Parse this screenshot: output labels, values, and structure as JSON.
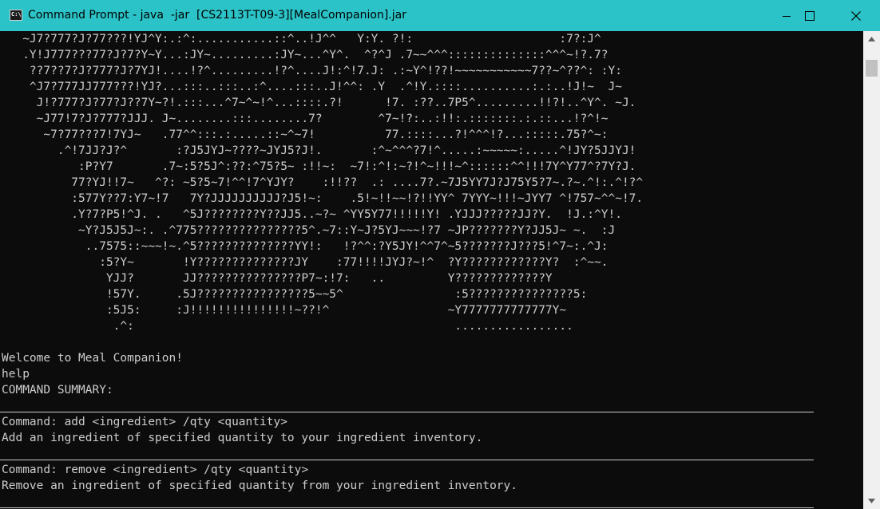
{
  "window": {
    "title": "Command Prompt - java  -jar  [CS2113T-T09-3][MealCompanion].jar",
    "controls": [
      "minimize-icon",
      "maximize-icon",
      "close-icon"
    ]
  },
  "console": {
    "ascii_art": [
      "   ~J7?777?J?77???!YJ^Y:.:^:...........::^..!J^^   Y:Y. ?!:                     :7?:J^",
      "   .Y!J777???77?J?7?Y~Y...:JY~.........:JY~...^Y^.  ^?^J .7~~^^^::::::::::::::^^^~!?.7?",
      "    ??7??7?J?777?J?7YJ!....!?^.........!?^....J!:^!7.J: .:~Y^!??!~~~~~~~~~~~7??~^??^: :Y:",
      "    ^J7?777JJ777???!YJ?...:::..:::..:^....:::..J!^^: .Y  .^!Y.::::..........:.:..!J!~  J~",
      "     J!?777?J?77?J??7Y~?!.:::...^7~^~!^...::::.?!      !7. :??..7P5^.........!!?!..^Y^. ~J.",
      "     ~J77!7?J?777?JJJ. J~........:::........7?        ^7~!?:..:!!:.:::::::.:.::...!?^!~",
      "      ~7?77???7!7YJ~   .77^^:::.:.....::~^~7!          77.::::...?!^^^!?...:::::.75?^~:",
      "        .^!7JJ?J?^       :?J5JYJ~????~JYJ5?J!.       :^~^^^?7!^.....:~~~~~:.....^!JY?5JJYJ!",
      "           :P?Y7       .7~:5?5J^:??:^75?5~ :!!~:  ~7!:^!:~?!^~!!!~^::::::^^!!!7Y^Y77^?7Y?J.",
      "          77?YJ!!7~   ^?: ~5?5~7!^^!7^YJY?    :!!??  .: ....7?.~7J5YY7J?J75Y5?7~.?~.^!:.^!?^",
      "          :577Y??7:Y7~!7   7Y?JJJJJJJJJJ?J5!~:    .5!~!!~~!?!!YY^ 7YYY~!!!~JYY7 ^!757~^^~!7.",
      "          .Y?7?P5!^J. .   ^5J????????Y??JJ5..~?~ ^YY5Y77!!!!!Y! .YJJJ?????JJ?Y.  !J.:^Y!.",
      "           ~Y?J5J5J~:. .^775???????????????5^.~7::Y~J?5YJ~~~!?7 ~JP???????Y?JJ5J~ ~.  :J",
      "            ..7575::~~~!~.^5??????????????YY!:   !?^^:?Y5JY!^^7^~5???????J???5!^7~:.^J:",
      "              :5?Y~       !Y??????????????JY    :77!!!!JYJ?~!^  ?Y????????????Y?  :^~~.",
      "               YJJ?       JJ???????????????P7~:!7:   ..         Y?????????????Y",
      "               !57Y.     .5J????????????????5~~5^                :5???????????????5:",
      "               :5J5:     :J!!!!!!!!!!!!!!!~??!^                 ~Y7777777777777Y~",
      "                .^:                                              ................."
    ],
    "welcome": "Welcome to Meal Companion!",
    "input_command": "help",
    "summary_heading": "COMMAND SUMMARY:",
    "commands": [
      {
        "command": "Command: add <ingredient> /qty <quantity>",
        "description": "Add an ingredient of specified quantity to your ingredient inventory."
      },
      {
        "command": "Command: remove <ingredient> /qty <quantity>",
        "description": "Remove an ingredient of specified quantity from your ingredient inventory."
      }
    ]
  },
  "colors": {
    "titlebar": "#2bc3c7",
    "console_bg": "#0c0c0c",
    "console_fg": "#cccccc"
  }
}
